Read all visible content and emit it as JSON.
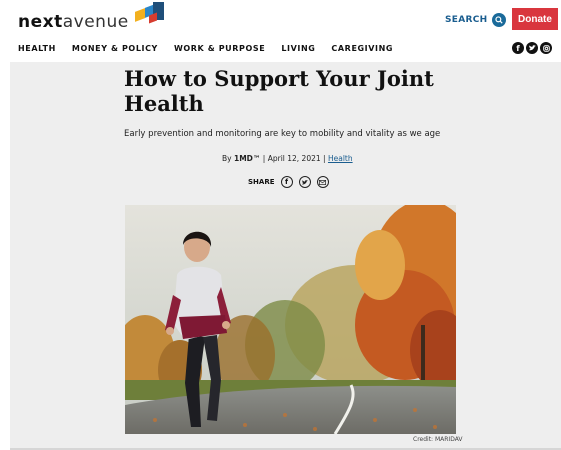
{
  "header": {
    "logo_bold": "next",
    "logo_light": "avenue",
    "search_label": "SEARCH",
    "donate_label": "Donate"
  },
  "nav": {
    "items": [
      "HEALTH",
      "MONEY & POLICY",
      "WORK & PURPOSE",
      "LIVING",
      "CAREGIVING"
    ]
  },
  "social": {
    "icons": [
      "facebook-icon",
      "twitter-icon",
      "instagram-icon"
    ]
  },
  "article": {
    "title": "How to Support Your Joint Health",
    "dek": "Early prevention and monitoring are key to mobility and vitality as we age",
    "byline_prefix": "By",
    "author": "1MD™",
    "date": "April 12, 2021",
    "category": "Health",
    "share_label": "SHARE",
    "photo_credit": "Credit: MARIDAV"
  },
  "colors": {
    "accent_blue": "#1a5d8f",
    "donate_red": "#d9363e",
    "article_bg": "#eeeeee"
  }
}
